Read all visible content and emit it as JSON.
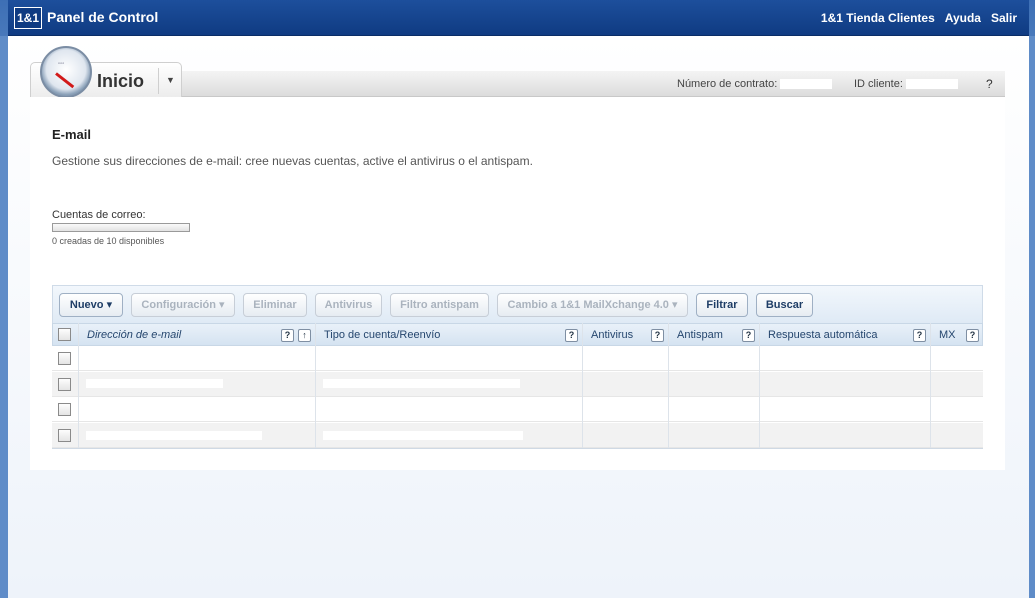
{
  "header": {
    "logo_text": "1&1",
    "title": "Panel de Control",
    "links": [
      "1&1 Tienda Clientes",
      "Ayuda",
      "Salir"
    ]
  },
  "tab": {
    "title": "Inicio",
    "contract_label": "Número de contrato:",
    "client_label": "ID cliente:",
    "help_label": "?"
  },
  "main": {
    "heading": "E-mail",
    "description": "Gestione sus direcciones de e-mail: cree nuevas cuentas, active el antivirus o el antispam.",
    "quota_label": "Cuentas de correo:",
    "quota_text": "0 creadas de 10 disponibles",
    "quota_fraction": 0
  },
  "toolbar": {
    "nuevo": "Nuevo ▾",
    "configuracion": "Configuración ▾",
    "eliminar": "Eliminar",
    "antivirus": "Antivirus",
    "filtro": "Filtro antispam",
    "cambio": "Cambio a 1&1 MailXchange 4.0 ▾",
    "filtrar": "Filtrar",
    "buscar": "Buscar"
  },
  "table": {
    "columns": [
      "Dirección de e-mail",
      "Tipo de cuenta/Reenvío",
      "Antivirus",
      "Antispam",
      "Respuesta automática",
      "MX"
    ],
    "help_glyph": "?",
    "sort_glyph": "↑"
  },
  "icons": {
    "gauge": "speedometer-icon",
    "arrow": "chevron-down-icon"
  }
}
